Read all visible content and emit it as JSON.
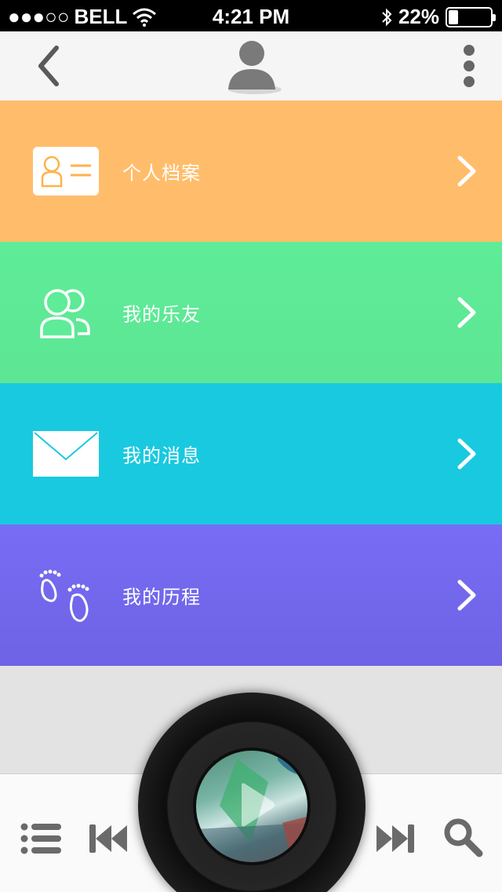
{
  "status_bar": {
    "signal": "●●●○○",
    "carrier": "BELL",
    "time": "4:21 PM",
    "battery_percent": "22%",
    "battery_level": 0.22
  },
  "header": {
    "back_icon": "chevron-left-icon",
    "avatar_icon": "user-silhouette-icon",
    "more_icon": "vertical-dots-icon"
  },
  "menu": {
    "items": [
      {
        "label": "个人档案",
        "icon": "profile-card-icon",
        "color": "#ffbd6b"
      },
      {
        "label": "我的乐友",
        "icon": "friends-icon",
        "color": "#5eec98"
      },
      {
        "label": "我的消息",
        "icon": "envelope-icon",
        "color": "#19c9df"
      },
      {
        "label": "我的历程",
        "icon": "footprints-icon",
        "color": "#786cf5"
      }
    ]
  },
  "player": {
    "list_icon": "list-icon",
    "prev_icon": "skip-back-icon",
    "play_icon": "play-icon",
    "next_icon": "skip-forward-icon",
    "search_icon": "search-icon"
  }
}
